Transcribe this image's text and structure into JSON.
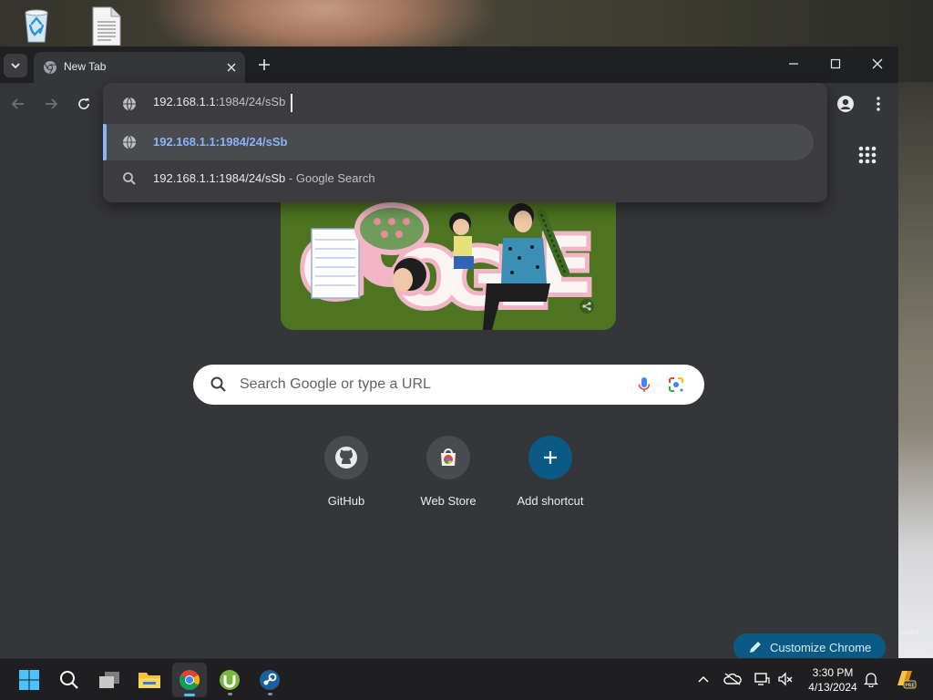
{
  "desktop": {
    "icons": [
      "recycle-bin-icon",
      "text-document-icon"
    ],
    "background_text": "ecent"
  },
  "browser": {
    "tab": {
      "title": "New Tab"
    },
    "omnibox": {
      "host": "192.168.1.1",
      "path": ":1984/24/sSb",
      "suggestions": [
        {
          "text": "192.168.1.1:1984/24/sSb",
          "suffix": "",
          "icon": "globe-icon"
        },
        {
          "text": "192.168.1.1:1984/24/sSb",
          "suffix": " - Google Search",
          "icon": "search-icon"
        }
      ]
    },
    "ntp": {
      "search_placeholder": "Search Google or type a URL",
      "shortcuts": [
        {
          "label": "GitHub",
          "icon": "github-icon"
        },
        {
          "label": "Web Store",
          "icon": "web-store-icon"
        },
        {
          "label": "Add shortcut",
          "icon": "plus-icon"
        }
      ],
      "customize_label": "Customize Chrome",
      "doodle_word": "GOOGLE"
    }
  },
  "taskbar": {
    "apps": [
      "start-icon",
      "search-icon",
      "task-view-icon",
      "file-explorer-icon",
      "chrome-icon",
      "utorrent-icon",
      "steam-icon"
    ],
    "time": "3:30 PM",
    "date": "4/13/2024",
    "accent": "#4cc2ff"
  }
}
